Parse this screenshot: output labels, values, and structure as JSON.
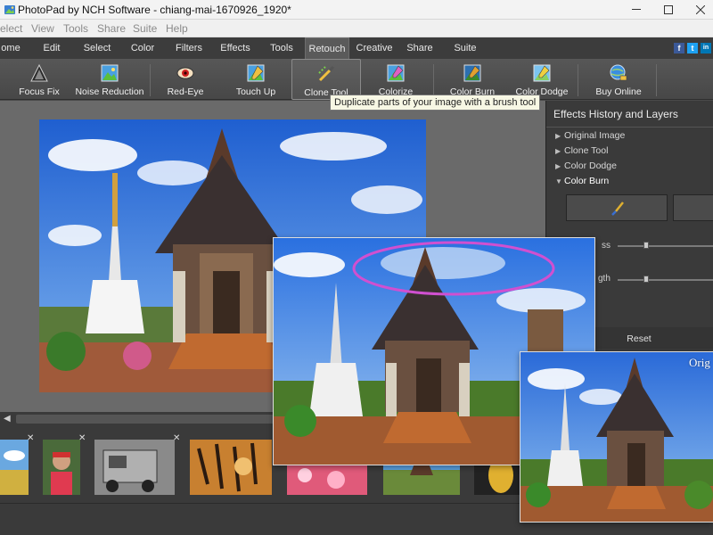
{
  "window": {
    "title": "PhotoPad by NCH Software - chiang-mai-1670926_1920*"
  },
  "menu": [
    "elect",
    "View",
    "Tools",
    "Share",
    "Suite",
    "Help"
  ],
  "ribbon_tabs": [
    "ome",
    "Edit",
    "Select",
    "Color",
    "Filters",
    "Effects",
    "Tools",
    "Retouch",
    "Creative",
    "Share",
    "Suite"
  ],
  "active_ribbon_tab": "Retouch",
  "social": {
    "facebook": "f",
    "twitter": "t",
    "linkedin": "in"
  },
  "toolbar": {
    "focus_fix": "Focus Fix",
    "noise_reduction": "Noise Reduction",
    "red_eye": "Red-Eye",
    "touch_up": "Touch Up",
    "clone_tool": "Clone Tool",
    "colorize": "Colorize",
    "color_burn": "Color Burn",
    "color_dodge": "Color Dodge",
    "buy_online": "Buy Online"
  },
  "tooltip": "Duplicate parts of your image with a brush tool",
  "panel": {
    "title": "Effects History and Layers",
    "history": [
      "Original Image",
      "Clone Tool",
      "Color Dodge",
      "Color Burn"
    ],
    "expanded_item": "Color Burn",
    "slider_labels": [
      "ss",
      "gth"
    ],
    "reset_label": "Reset"
  },
  "overlay": {
    "original_label": "Orig"
  },
  "colors": {
    "accent_ellipse": "#d050d0",
    "ribbon_bg": "#3c3c3c",
    "toolbar_bg": "#4f4f4f",
    "panel_bg": "#3a3a3a"
  }
}
